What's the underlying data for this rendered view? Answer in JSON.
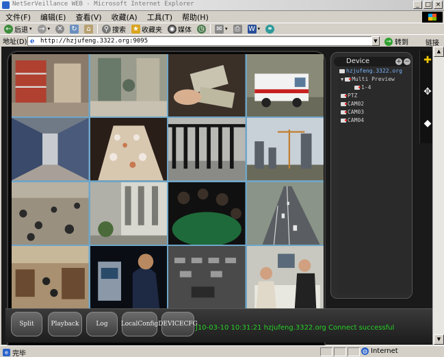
{
  "window": {
    "title": "NetSerVeillance WEB - Microsoft Internet Explorer",
    "min": "_",
    "max": "□",
    "close": "×"
  },
  "menu": [
    "文件(F)",
    "编辑(E)",
    "查看(V)",
    "收藏(A)",
    "工具(T)",
    "帮助(H)"
  ],
  "toolbar": {
    "back": "后退",
    "search": "搜索",
    "favorites": "收藏夹",
    "media": "媒体"
  },
  "address": {
    "label": "地址(D)",
    "url": "http://hzjufeng.3322.org:9095",
    "go": "转到",
    "links": "链接"
  },
  "device_panel": {
    "title": "Device",
    "add": "+",
    "remove": "−",
    "tree": {
      "server": "hzjufeng.3322.org",
      "group": "Multi Preview",
      "group_child": "1-4",
      "cameras": [
        "PTZ",
        "CAM02",
        "CAM03",
        "CAM04"
      ]
    }
  },
  "buttons": {
    "split": "Split",
    "playback": "Playback",
    "log": "Log",
    "localconfig": "LocalConfig",
    "devicecfg": "DEVICECFG"
  },
  "status_message": "J10-03-10  10:31:21  hzjufeng.3322.org  Connect successful",
  "statusbar": {
    "done": "完毕",
    "zone": "Internet"
  },
  "colors": {
    "status_green": "#27d327",
    "grid_border": "#6fa6c8",
    "server_blue": "#7ab6ff"
  }
}
